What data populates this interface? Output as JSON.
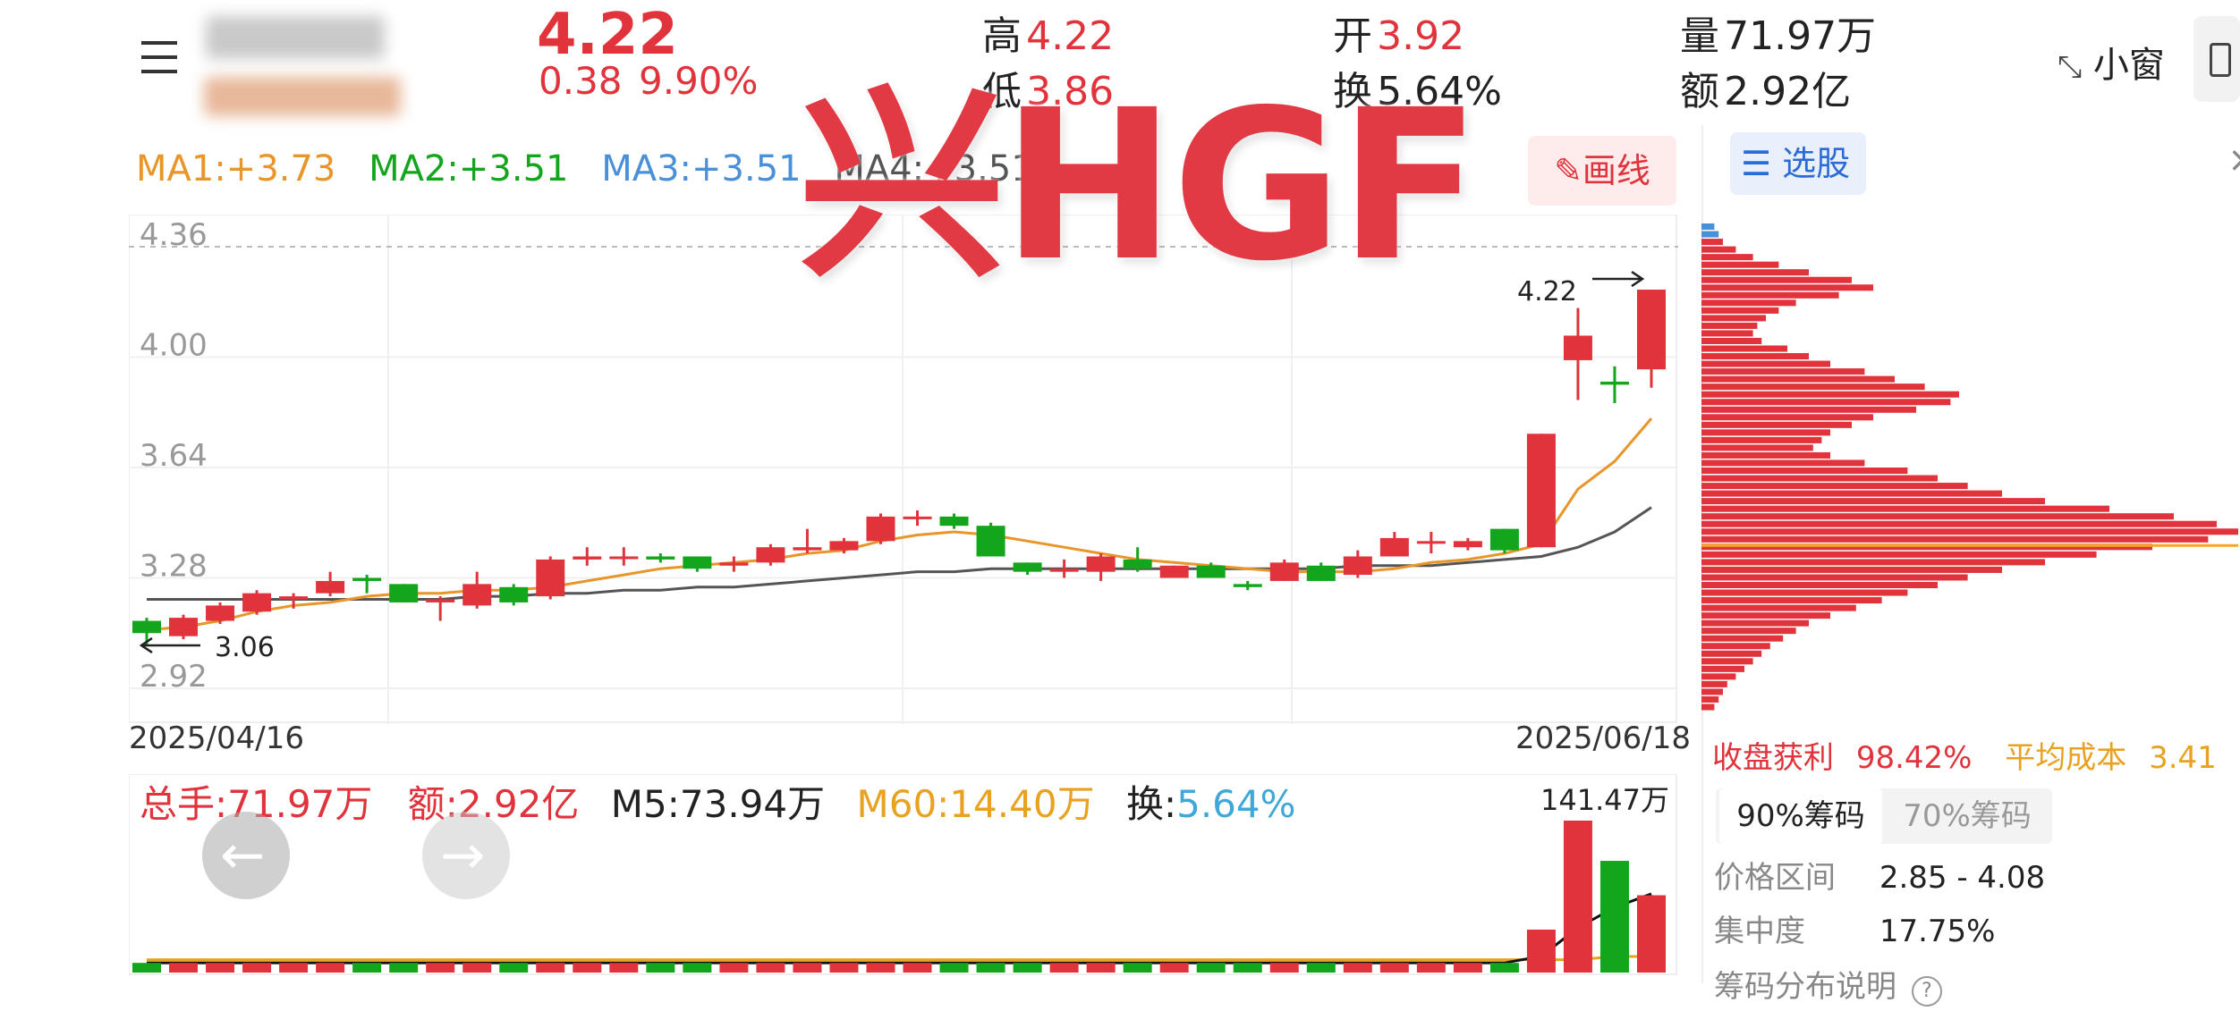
{
  "header": {
    "menu_icon": "menu-icon",
    "price": "4.22",
    "change": "0.38",
    "change_pct": "9.90%",
    "high_label": "高",
    "high": "4.22",
    "low_label": "低",
    "low": "3.86",
    "open_label": "开",
    "open": "3.92",
    "turnover_label": "换",
    "turnover": "5.64%",
    "volume_label": "量",
    "volume": "71.97万",
    "amount_label": "额",
    "amount": "2.92亿",
    "small_window_label": "小窗",
    "small_window_icon": "shrink-icon",
    "device_icon": "phone-icon"
  },
  "ma_bar": {
    "ma1": "MA1:+3.73",
    "ma2": "MA2:+3.51",
    "ma3": "MA3:+3.51",
    "ma4": "MA4:+3.51",
    "draw_button": "画线",
    "draw_icon": "pencil-icon"
  },
  "watermark": "兴HGF",
  "chart_data": {
    "type": "candlestick",
    "date_start": "2025/04/16",
    "date_end": "2025/06/18",
    "y_ticks": [
      "4.36",
      "4.00",
      "3.64",
      "3.28",
      "2.92"
    ],
    "ylim": [
      2.92,
      4.36
    ],
    "max_label": "4.22",
    "min_label": "3.06",
    "candles": [
      {
        "o": 3.14,
        "c": 3.1,
        "h": 3.15,
        "l": 3.06
      },
      {
        "o": 3.09,
        "c": 3.15,
        "h": 3.16,
        "l": 3.08
      },
      {
        "o": 3.14,
        "c": 3.19,
        "h": 3.2,
        "l": 3.13
      },
      {
        "o": 3.17,
        "c": 3.23,
        "h": 3.24,
        "l": 3.16
      },
      {
        "o": 3.21,
        "c": 3.22,
        "h": 3.23,
        "l": 3.18
      },
      {
        "o": 3.23,
        "c": 3.27,
        "h": 3.3,
        "l": 3.22
      },
      {
        "o": 3.28,
        "c": 3.27,
        "h": 3.29,
        "l": 3.23
      },
      {
        "o": 3.26,
        "c": 3.2,
        "h": 3.26,
        "l": 3.2
      },
      {
        "o": 3.2,
        "c": 3.21,
        "h": 3.22,
        "l": 3.14
      },
      {
        "o": 3.19,
        "c": 3.26,
        "h": 3.3,
        "l": 3.18
      },
      {
        "o": 3.25,
        "c": 3.2,
        "h": 3.26,
        "l": 3.19
      },
      {
        "o": 3.22,
        "c": 3.34,
        "h": 3.35,
        "l": 3.21
      },
      {
        "o": 3.34,
        "c": 3.35,
        "h": 3.38,
        "l": 3.32
      },
      {
        "o": 3.35,
        "c": 3.35,
        "h": 3.38,
        "l": 3.32
      },
      {
        "o": 3.35,
        "c": 3.34,
        "h": 3.36,
        "l": 3.33
      },
      {
        "o": 3.35,
        "c": 3.31,
        "h": 3.35,
        "l": 3.3
      },
      {
        "o": 3.32,
        "c": 3.33,
        "h": 3.35,
        "l": 3.3
      },
      {
        "o": 3.33,
        "c": 3.38,
        "h": 3.39,
        "l": 3.32
      },
      {
        "o": 3.37,
        "c": 3.38,
        "h": 3.44,
        "l": 3.36
      },
      {
        "o": 3.37,
        "c": 3.4,
        "h": 3.41,
        "l": 3.36
      },
      {
        "o": 3.4,
        "c": 3.48,
        "h": 3.49,
        "l": 3.39
      },
      {
        "o": 3.48,
        "c": 3.48,
        "h": 3.5,
        "l": 3.45
      },
      {
        "o": 3.48,
        "c": 3.45,
        "h": 3.49,
        "l": 3.44
      },
      {
        "o": 3.45,
        "c": 3.35,
        "h": 3.46,
        "l": 3.35
      },
      {
        "o": 3.33,
        "c": 3.3,
        "h": 3.33,
        "l": 3.29
      },
      {
        "o": 3.3,
        "c": 3.31,
        "h": 3.34,
        "l": 3.28
      },
      {
        "o": 3.3,
        "c": 3.35,
        "h": 3.36,
        "l": 3.27
      },
      {
        "o": 3.34,
        "c": 3.31,
        "h": 3.38,
        "l": 3.3
      },
      {
        "o": 3.28,
        "c": 3.32,
        "h": 3.32,
        "l": 3.28
      },
      {
        "o": 3.32,
        "c": 3.28,
        "h": 3.33,
        "l": 3.28
      },
      {
        "o": 3.26,
        "c": 3.25,
        "h": 3.27,
        "l": 3.24
      },
      {
        "o": 3.27,
        "c": 3.33,
        "h": 3.34,
        "l": 3.27
      },
      {
        "o": 3.32,
        "c": 3.27,
        "h": 3.33,
        "l": 3.27
      },
      {
        "o": 3.29,
        "c": 3.35,
        "h": 3.37,
        "l": 3.28
      },
      {
        "o": 3.35,
        "c": 3.41,
        "h": 3.43,
        "l": 3.35
      },
      {
        "o": 3.4,
        "c": 3.4,
        "h": 3.43,
        "l": 3.36
      },
      {
        "o": 3.38,
        "c": 3.4,
        "h": 3.41,
        "l": 3.37
      },
      {
        "o": 3.44,
        "c": 3.37,
        "h": 3.44,
        "l": 3.36
      },
      {
        "o": 3.38,
        "c": 3.75,
        "h": 3.75,
        "l": 3.38
      },
      {
        "o": 3.99,
        "c": 4.07,
        "h": 4.16,
        "l": 3.86
      },
      {
        "o": 3.92,
        "c": 3.91,
        "h": 3.97,
        "l": 3.85
      },
      {
        "o": 3.96,
        "c": 4.22,
        "h": 4.22,
        "l": 3.9
      }
    ],
    "ma1_line": [
      3.11,
      3.12,
      3.14,
      3.17,
      3.19,
      3.2,
      3.22,
      3.23,
      3.23,
      3.24,
      3.24,
      3.25,
      3.27,
      3.29,
      3.31,
      3.32,
      3.33,
      3.34,
      3.36,
      3.37,
      3.4,
      3.42,
      3.43,
      3.42,
      3.4,
      3.38,
      3.36,
      3.34,
      3.33,
      3.32,
      3.31,
      3.3,
      3.3,
      3.3,
      3.31,
      3.33,
      3.34,
      3.36,
      3.39,
      3.57,
      3.66,
      3.8
    ],
    "ma2_line": [
      3.21,
      3.21,
      3.21,
      3.21,
      3.21,
      3.21,
      3.21,
      3.21,
      3.21,
      3.22,
      3.22,
      3.23,
      3.23,
      3.24,
      3.24,
      3.25,
      3.25,
      3.26,
      3.27,
      3.28,
      3.29,
      3.3,
      3.3,
      3.31,
      3.31,
      3.31,
      3.31,
      3.31,
      3.31,
      3.31,
      3.31,
      3.31,
      3.31,
      3.32,
      3.32,
      3.32,
      3.33,
      3.34,
      3.35,
      3.38,
      3.43,
      3.51
    ],
    "volume": {
      "total": "总手:71.97万",
      "amount": "额:2.92亿",
      "m5": "M5:73.94万",
      "m60": "M60:14.40万",
      "turnover_label": "换:",
      "turnover": "5.64%",
      "max_label": "141.47万",
      "max": 141.47,
      "bars_last": [
        40,
        141.47,
        104,
        71.97
      ]
    }
  },
  "nav": {
    "prev_icon": "arrow-left-icon",
    "next_icon": "arrow-right-icon"
  },
  "chip_panel": {
    "title": "选股",
    "title_icon": "list-icon",
    "close_icon": "close-icon",
    "profit_label": "收盘获利",
    "profit": "98.42%",
    "avg_cost_label": "平均成本",
    "avg_cost": "3.41",
    "tab_90": "90%筹码",
    "tab_70": "70%筹码",
    "range_label": "价格区间",
    "range": "2.85 - 4.08",
    "concentration_label": "集中度",
    "concentration": "17.75%",
    "desc_label": "筹码分布说明",
    "help_icon": "question-icon",
    "avg_cost_price": 3.41,
    "distribution": [
      3,
      4,
      5,
      8,
      12,
      18,
      25,
      35,
      40,
      32,
      22,
      18,
      15,
      13,
      12,
      14,
      20,
      25,
      30,
      38,
      45,
      52,
      60,
      58,
      50,
      40,
      35,
      30,
      28,
      26,
      30,
      38,
      48,
      55,
      62,
      70,
      80,
      95,
      110,
      120,
      125,
      118,
      105,
      92,
      80,
      70,
      62,
      55,
      48,
      42,
      36,
      30,
      25,
      22,
      19,
      16,
      14,
      12,
      10,
      8,
      6,
      5,
      4,
      3
    ]
  },
  "colors": {
    "up": "#e0333b",
    "down": "#13a51b",
    "ma1": "#e8952a",
    "ma2": "#555555",
    "ma3": "#4a90d9",
    "avg_cost_line": "#f5a623"
  }
}
